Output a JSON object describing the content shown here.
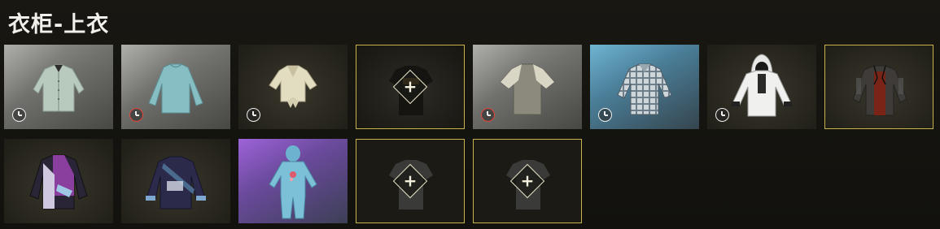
{
  "title": "衣柜-上衣",
  "colors": {
    "selected_border": "#c9b24a",
    "timer_red": "#e3473d",
    "timer_white": "#efefef",
    "background": "#15140f"
  },
  "slots": [
    {
      "name": "light-green-button-shirt",
      "state": "item",
      "rarity_bg": "gray",
      "badge": "clock-white",
      "icon": "button-shirt-icon"
    },
    {
      "name": "teal-long-sleeve-shirt",
      "state": "item",
      "rarity_bg": "gray",
      "badge": "clock-red",
      "icon": "long-sleeve-shirt-icon"
    },
    {
      "name": "tied-cream-blouse",
      "state": "item",
      "rarity_bg": "dark",
      "badge": "clock-white",
      "icon": "tied-blouse-icon"
    },
    {
      "name": "empty-slot-equipped-tshirt",
      "state": "add",
      "equipped": true,
      "icon": "add-icon"
    },
    {
      "name": "raglan-tshirt",
      "state": "item",
      "rarity_bg": "gray",
      "badge": "clock-red",
      "icon": "raglan-tshirt-icon"
    },
    {
      "name": "plaid-shirt",
      "state": "item",
      "rarity_bg": "blue",
      "badge": "clock-white",
      "icon": "plaid-shirt-icon"
    },
    {
      "name": "white-hoodie",
      "state": "item",
      "rarity_bg": "dark",
      "badge": "clock-white",
      "icon": "hoodie-icon"
    },
    {
      "name": "leather-jacket-selected",
      "state": "item",
      "rarity_bg": "dark",
      "selected": true,
      "icon": "leather-jacket-icon"
    },
    {
      "name": "purple-track-jacket",
      "state": "item",
      "rarity_bg": "dark",
      "icon": "track-jacket-icon"
    },
    {
      "name": "navy-sweater",
      "state": "item",
      "rarity_bg": "dark",
      "icon": "sweater-icon"
    },
    {
      "name": "blue-onesie",
      "state": "item",
      "rarity_bg": "purple",
      "icon": "onesie-icon"
    },
    {
      "name": "empty-slot-1",
      "state": "add",
      "icon": "add-icon"
    },
    {
      "name": "empty-slot-2",
      "state": "add",
      "icon": "add-icon"
    }
  ],
  "add_symbol": "+"
}
